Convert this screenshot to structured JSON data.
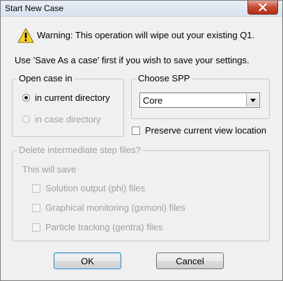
{
  "window": {
    "title": "Start New Case"
  },
  "warning": {
    "icon": "warning-icon",
    "text": "Warning: This operation will wipe out your existing Q1.",
    "hint": "Use 'Save As a case' first if you wish to save your settings."
  },
  "open_case": {
    "legend": "Open case in",
    "options": [
      {
        "label": "in current directory",
        "selected": true,
        "enabled": true
      },
      {
        "label": "in case directory",
        "selected": false,
        "enabled": false
      }
    ]
  },
  "spp": {
    "legend": "Choose SPP",
    "selected": "Core"
  },
  "preserve_view": {
    "label": "Preserve current view location",
    "checked": false
  },
  "delete_files": {
    "legend": "Delete intermediate step files?",
    "subtitle": "This will save",
    "items": [
      {
        "label": "Solution output (phi) files",
        "checked": false
      },
      {
        "label": "Graphical monitoring (gxmoni) files",
        "checked": false
      },
      {
        "label": "Particle tracking (gentra) files",
        "checked": false
      }
    ]
  },
  "buttons": {
    "ok": "OK",
    "cancel": "Cancel"
  }
}
